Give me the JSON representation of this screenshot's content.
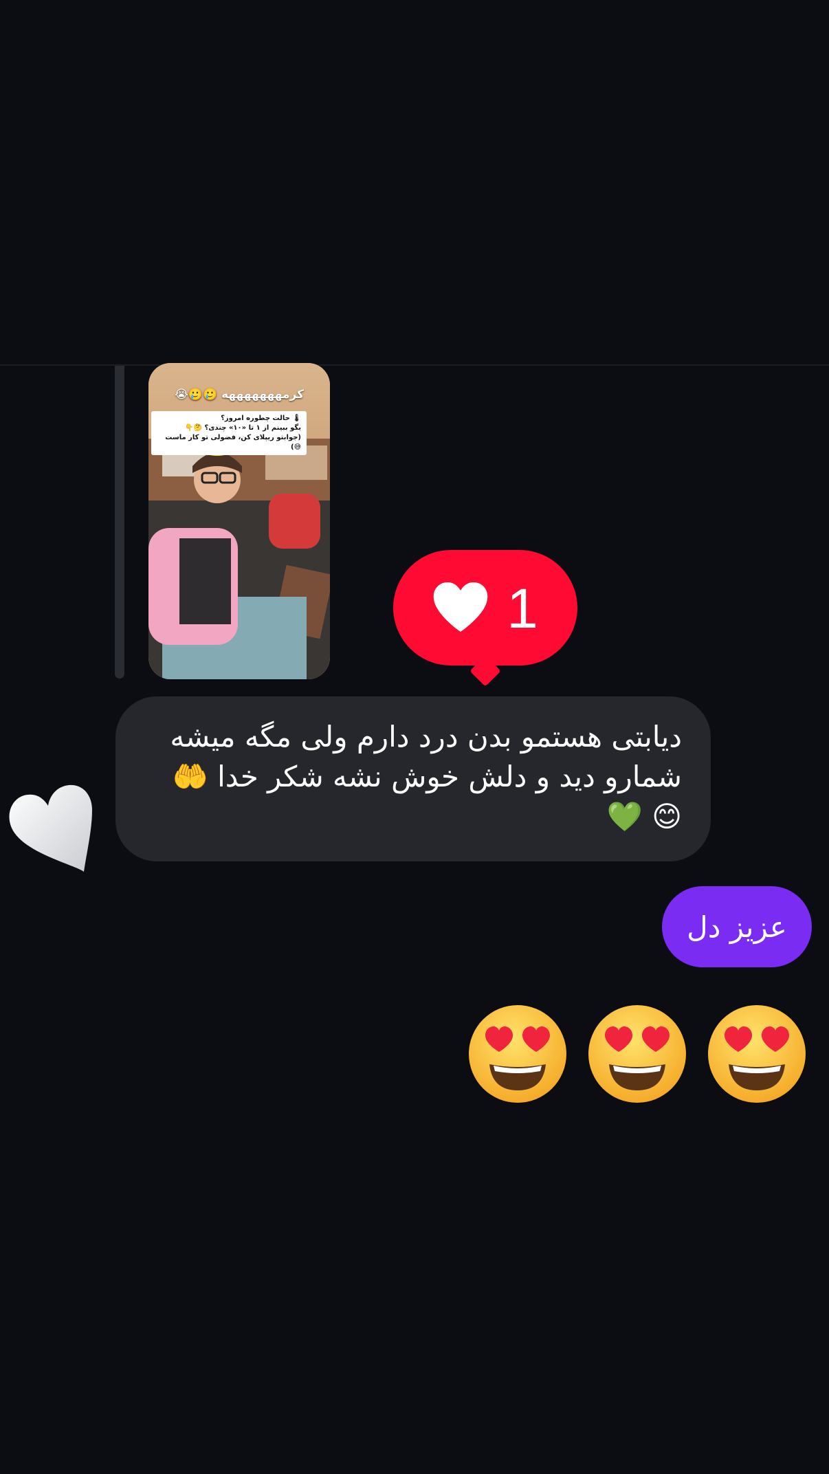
{
  "story_reply": {
    "caption": "کرمهههههههه 🥲🥲😭",
    "sticker_lines": [
      "🌡 حالت چطوره امروز؟",
      "بگو ببینم از ۱ تا «۱۰» چندی؟ 🤔👇",
      "(جوابتو ریپلای کن، فضولی تو کار ماست 😅)"
    ]
  },
  "reaction": {
    "icon": "heart-icon",
    "count": "1",
    "color": "#ff0a33"
  },
  "received_message": {
    "text": "دیابتی هستمو بدن درد دارم ولی مگه میشه شمارو دید و دلش خوش نشه شکر خدا 🤲 😊 💚",
    "bubble_color": "#25272d",
    "reaction_icon": "white-heart-icon"
  },
  "sent_message": {
    "text": "عزیز دل",
    "bubble_color": "#7a2cf2"
  },
  "emoji_message": {
    "emojis": [
      "heart-eyes-face-icon",
      "heart-eyes-face-icon",
      "heart-eyes-face-icon"
    ]
  },
  "colors": {
    "background": "#0c0d12",
    "accent_purple": "#7a2cf2",
    "like_red": "#ff0a33"
  }
}
